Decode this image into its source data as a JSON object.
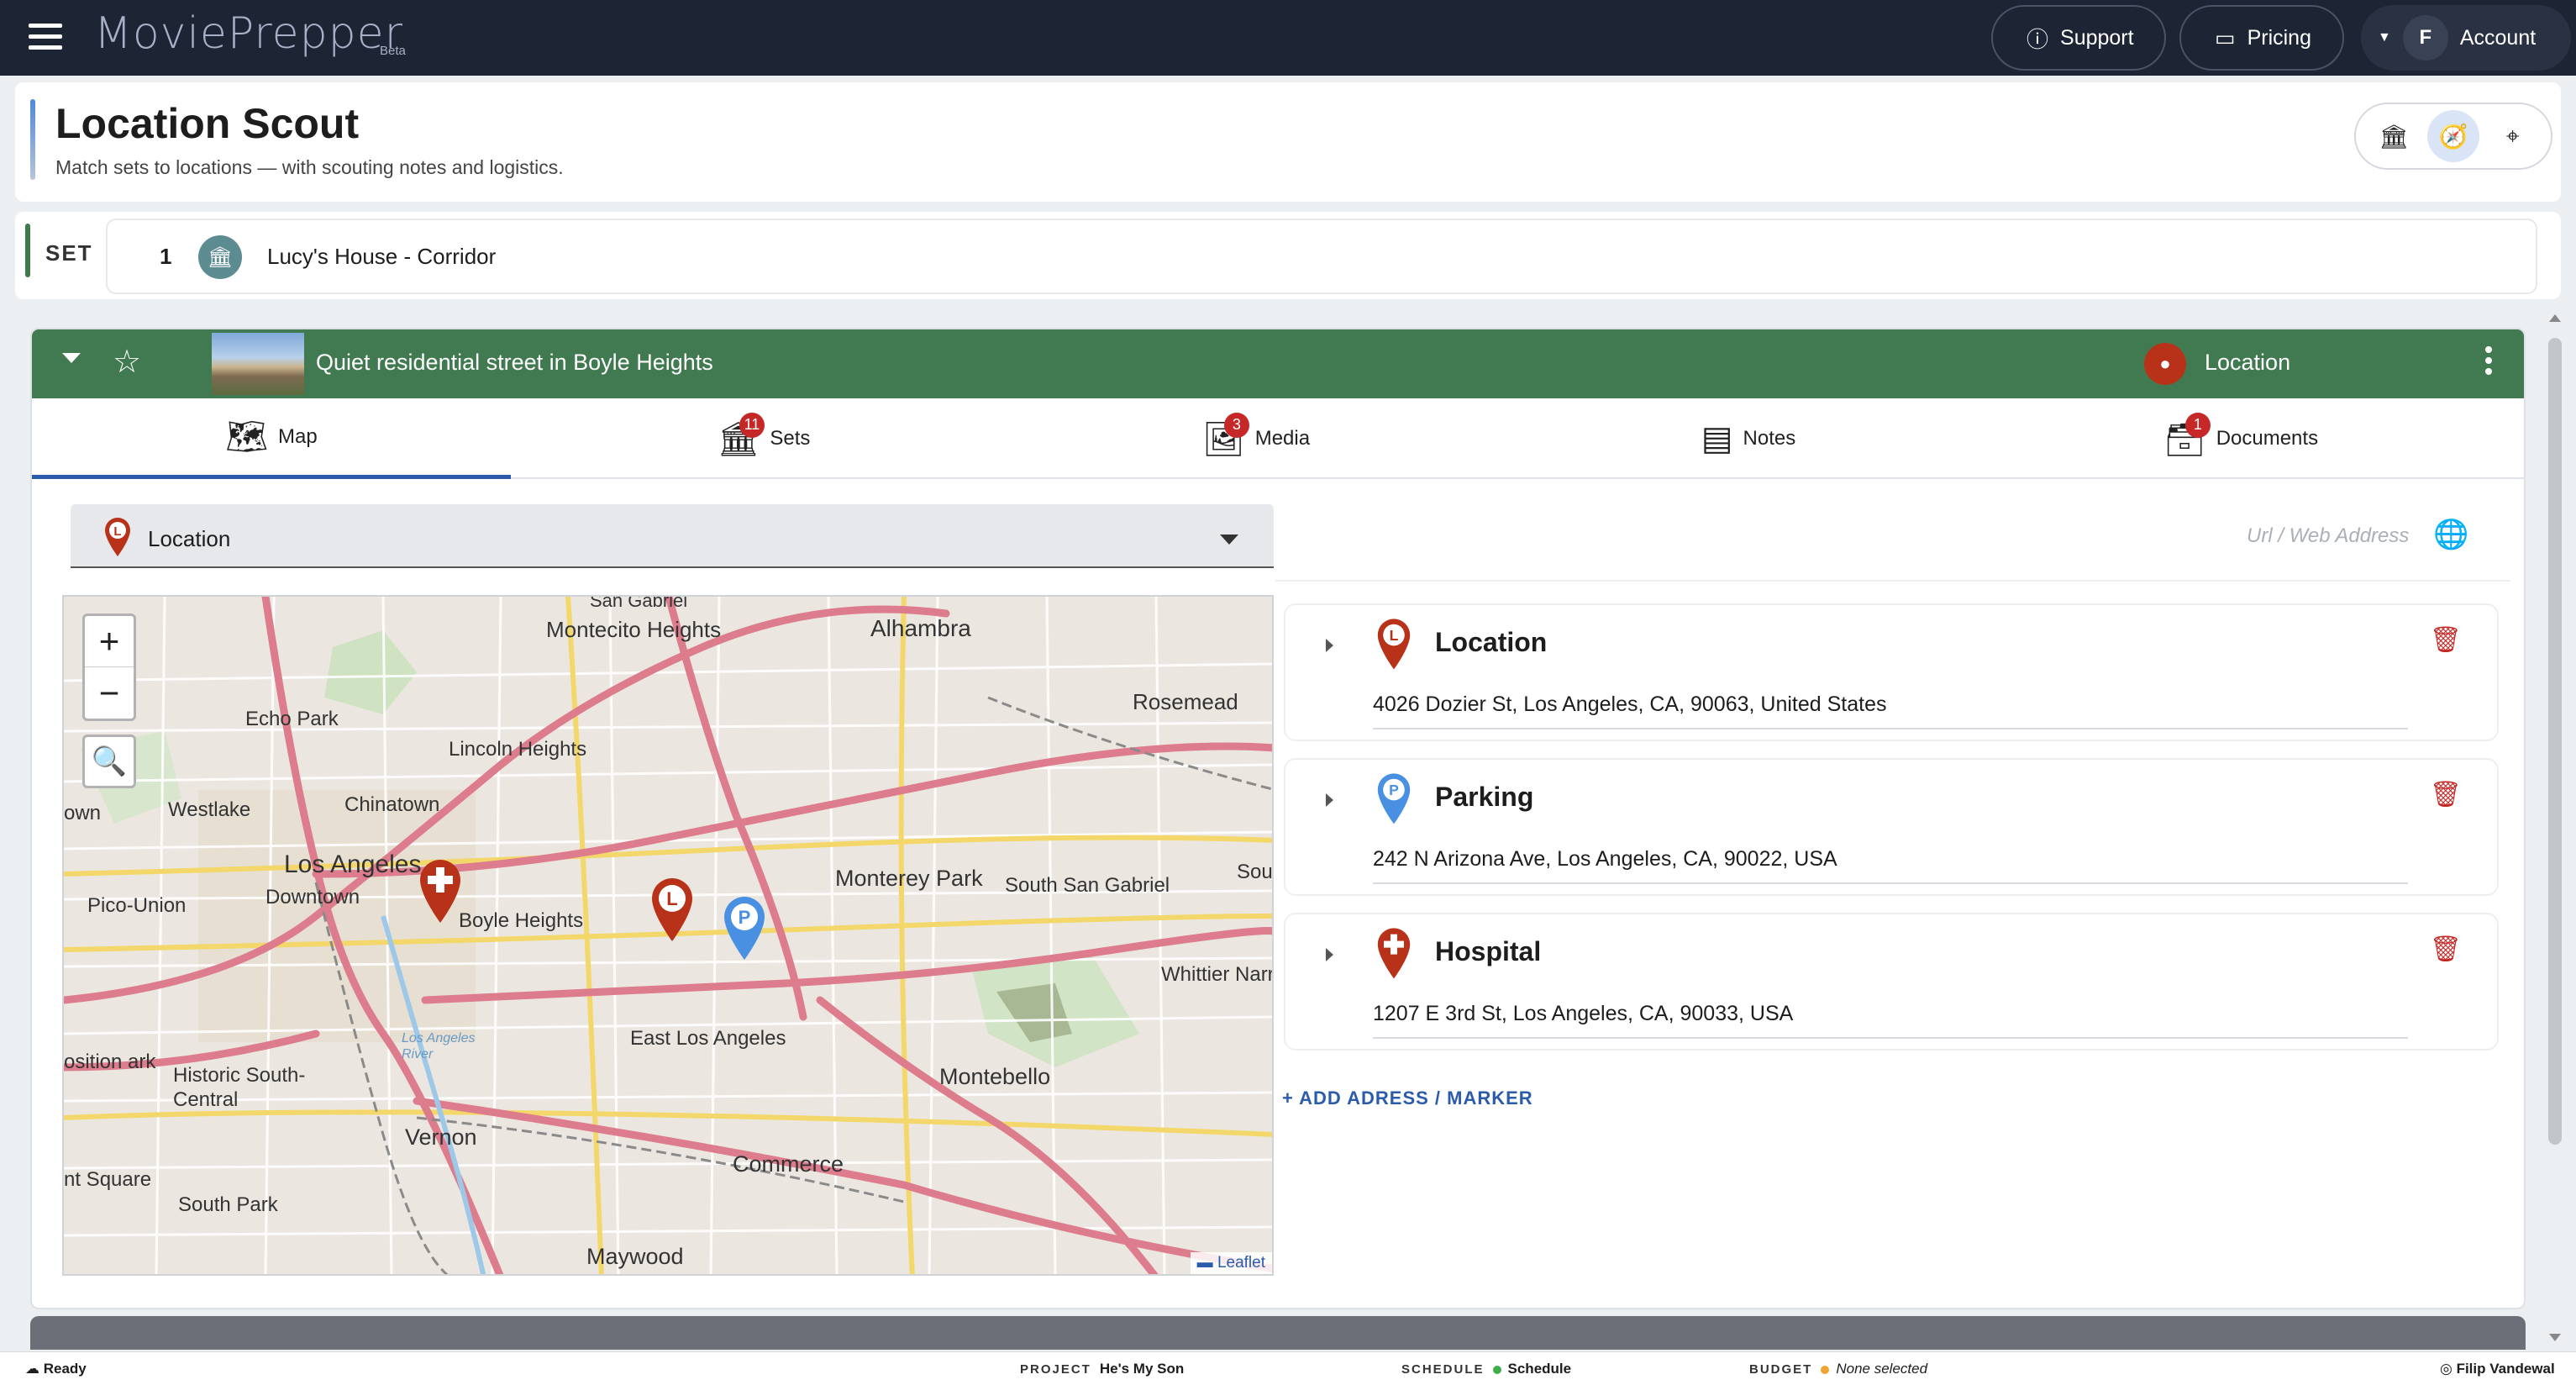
{
  "app": {
    "logo": "MoviePrepper",
    "logo_badge": "Beta"
  },
  "topnav": {
    "support": "Support",
    "pricing": "Pricing",
    "account": "Account",
    "account_initial": "F"
  },
  "header": {
    "title": "Location Scout",
    "subtitle": "Match sets to locations — with scouting notes and logistics."
  },
  "set": {
    "label": "SET",
    "number": "1",
    "name": "Lucy's House - Corridor"
  },
  "location_card": {
    "title": "Quiet residential street in Boyle Heights",
    "type_label": "Location",
    "tabs": [
      {
        "label": "Map",
        "icon": "map-icon",
        "badge": ""
      },
      {
        "label": "Sets",
        "icon": "pillar-icon",
        "badge": "11"
      },
      {
        "label": "Media",
        "icon": "image-icon",
        "badge": "3"
      },
      {
        "label": "Notes",
        "icon": "notes-icon",
        "badge": ""
      },
      {
        "label": "Documents",
        "icon": "box-icon",
        "badge": "1"
      }
    ],
    "select": {
      "value": "Location"
    },
    "url": {
      "placeholder": "Url / Web Address"
    },
    "map": {
      "attribution": "Leaflet",
      "labels": [
        "Montecito Heights",
        "Alhambra",
        "San Gabriel",
        "Echo Park",
        "Rosemead",
        "Lincoln Heights",
        "Chinatown",
        "Westlake",
        "Los Angeles",
        "Downtown",
        "Boyle Heights",
        "Monterey Park",
        "South San Gabriel",
        "Pico-Union",
        "Whittier Narr",
        "East Los Angeles",
        "Historic South-Central",
        "Montebello",
        "Vernon",
        "Commerce",
        "South Park",
        "Maywood",
        "Los Angeles River",
        "own",
        "osition ark",
        "nt Square",
        "Sou"
      ]
    },
    "addresses": [
      {
        "title": "Location",
        "address": "4026 Dozier St, Los Angeles, CA, 90063, United States",
        "marker": "L",
        "color": "#b83219"
      },
      {
        "title": "Parking",
        "address": "242 N Arizona Ave, Los Angeles, CA, 90022, USA",
        "marker": "P",
        "color": "#4a90e2"
      },
      {
        "title": "Hospital",
        "address": "1207 E 3rd St, Los Angeles, CA, 90033, USA",
        "marker": "+",
        "color": "#b83219"
      }
    ],
    "add_link": "+ ADD ADRESS / MARKER"
  },
  "status": {
    "ready": "Ready",
    "project_key": "PROJECT",
    "project_val": "He's My Son",
    "schedule_key": "SCHEDULE",
    "schedule_val": "Schedule",
    "budget_key": "BUDGET",
    "budget_val": "None selected",
    "user": "Filip Vandewal"
  }
}
